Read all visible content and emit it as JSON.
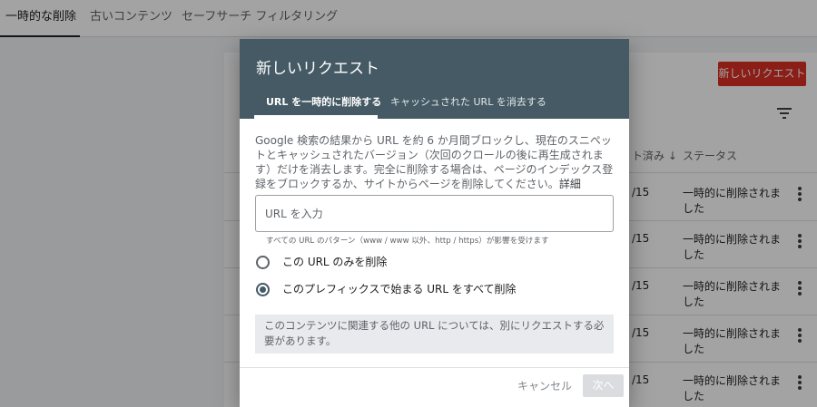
{
  "top_tabs": [
    {
      "label": "一時的な削除",
      "active": true
    },
    {
      "label": "古いコンテンツ",
      "active": false
    },
    {
      "label": "セーフサーチ フィルタリング",
      "active": false
    }
  ],
  "background": {
    "new_request_button": "新しいリクエスト",
    "columns": {
      "submitted": "ト済み ↓",
      "status": "ステータス"
    },
    "rows": [
      {
        "date": "/15",
        "status": "一時的に削除されました"
      },
      {
        "date": "/15",
        "status": "一時的に削除されました"
      },
      {
        "date": "/15",
        "status": "一時的に削除されました"
      },
      {
        "date": "/15",
        "status": "一時的に削除されました"
      },
      {
        "date": "/15",
        "status": "一時的に削除されました"
      }
    ]
  },
  "dialog": {
    "title": "新しいリクエスト",
    "tabs": [
      {
        "label": "URL を一時的に削除する",
        "active": true
      },
      {
        "label": "キャッシュされた URL を消去する",
        "active": false
      }
    ],
    "description": "Google 検索の結果から URL を約 6 か月間ブロックし、現在のスニペットとキャッシュされたバージョン（次回のクロールの後に再生成されます）だけを消去します。完全に削除する場合は、ページのインデックス登録をブロックするか、サイトからページを削除してください。",
    "description_link": "詳細",
    "url_input": {
      "placeholder": "URL を入力",
      "value": ""
    },
    "url_hint": "すべての URL のパターン（www / www 以外、http / https）が影響を受けます",
    "radios": [
      {
        "label": "この URL のみを削除",
        "checked": false
      },
      {
        "label": "このプレフィックスで始まる URL をすべて削除",
        "checked": true
      }
    ],
    "info": "このコンテンツに関連する他の URL については、別にリクエストする必要があります。",
    "cancel_label": "キャンセル",
    "next_label": "次へ"
  },
  "colors": {
    "dialog_header": "#455a64",
    "primary_button": "#d93025",
    "scrim": "rgba(0,0,0,0.36)"
  }
}
